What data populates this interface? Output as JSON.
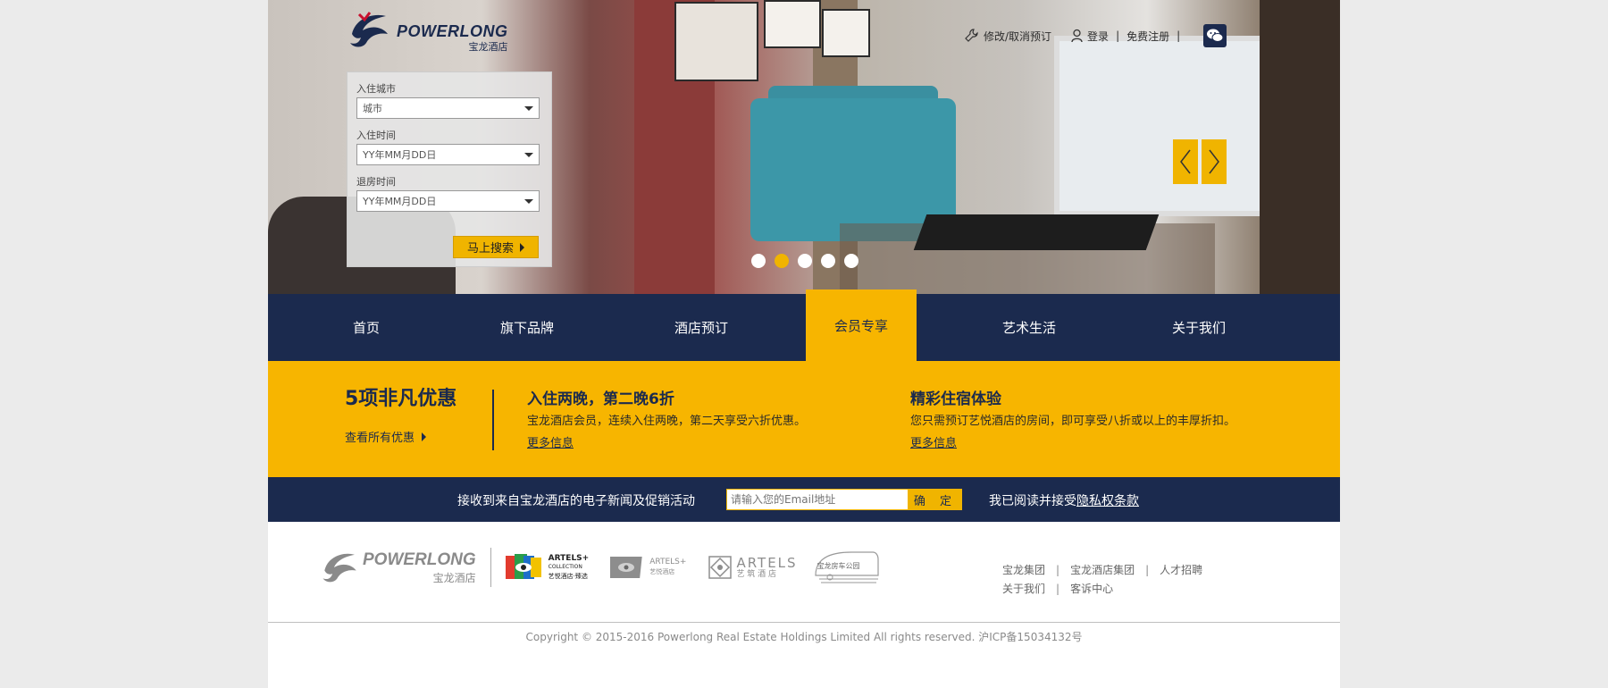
{
  "header": {
    "logo_en": "POWERLONG",
    "logo_cn": "宝龙酒店",
    "links": {
      "modify_cancel": "修改/取消预订",
      "login": "登录",
      "register": "免费注册",
      "sep": "|"
    }
  },
  "search": {
    "city_label": "入住城市",
    "city_value": "城市",
    "checkin_label": "入住时间",
    "checkin_value": "YY年MM月DD日",
    "checkout_label": "退房时间",
    "checkout_value": "YY年MM月DD日",
    "submit_label": "马上搜索"
  },
  "slider": {
    "active_index": 1,
    "count": 5
  },
  "nav": {
    "items": [
      {
        "label": "首页"
      },
      {
        "label": "旗下品牌"
      },
      {
        "label": "酒店预订"
      },
      {
        "label": "会员专享",
        "active": true
      },
      {
        "label": "艺术生活"
      },
      {
        "label": "关于我们"
      }
    ]
  },
  "promo": {
    "title": "5项非凡优惠",
    "view_all": "查看所有优惠",
    "offers": [
      {
        "title": "入住两晚，第二晚6折",
        "desc": "宝龙酒店会员，连续入住两晚，第二天享受六折优惠。",
        "more": "更多信息"
      },
      {
        "title": "精彩住宿体验",
        "desc": "您只需预订艺悦酒店的房间，即可享受八折或以上的丰厚折扣。",
        "more": "更多信息"
      }
    ]
  },
  "newsletter": {
    "text": "接收到来自宝龙酒店的电子新闻及促销活动",
    "placeholder": "请输入您的Email地址",
    "button": "确 定",
    "privacy_prefix": "我已阅读并接受",
    "privacy_link": "隐私权条款"
  },
  "footer": {
    "brand_logo_en": "POWERLONG",
    "brand_logo_cn": "宝龙酒店",
    "brands": {
      "artels_collection": "ARTELS+",
      "artels_collection_sub": "COLLECTION",
      "artels_collection_cn": "艺悦酒店·臻选",
      "artels_plus": "ARTELS+",
      "artels_plus_cn": "艺悦酒店",
      "artels": "ARTELS",
      "artels_cn": "艺 筑 酒 店",
      "rv_park": "宝龙房车公园"
    },
    "links_row1": [
      "宝龙集团",
      "宝龙酒店集团",
      "人才招聘"
    ],
    "links_row2": [
      "关于我们",
      "客诉中心"
    ],
    "sep": "|",
    "copyright": "Copyright © 2015-2016 Powerlong Real Estate Holdings Limited All rights reserved. 沪ICP备15034132号"
  },
  "colors": {
    "navy": "#1b2a4e",
    "gold": "#f7b500",
    "page_bg": "#ebebeb"
  }
}
